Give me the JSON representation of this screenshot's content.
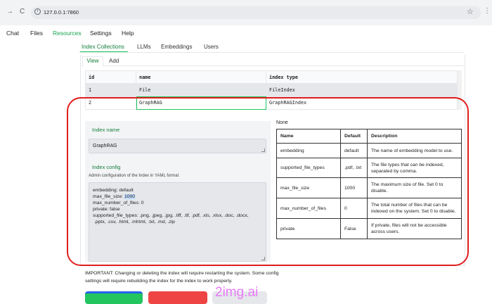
{
  "browser": {
    "back_glyph": "→",
    "reload_glyph": "C",
    "url": "127.0.0.1:7860",
    "star_glyph": "☆",
    "kebab_glyph": "⋮"
  },
  "menu": [
    {
      "label": "Chat"
    },
    {
      "label": "Files"
    },
    {
      "label": "Resources"
    },
    {
      "label": "Settings"
    },
    {
      "label": "Help"
    }
  ],
  "subtabs": [
    {
      "label": "Index Collections"
    },
    {
      "label": "LLMs"
    },
    {
      "label": "Embeddings"
    },
    {
      "label": "Users"
    }
  ],
  "view_tabs": {
    "view": "View",
    "add": "Add"
  },
  "index_table": {
    "headers": [
      "id",
      "name",
      "index type"
    ],
    "rows": [
      [
        "1",
        "File",
        "FileIndex"
      ],
      [
        "2",
        "GraphRAG",
        "GraphRAGIndex"
      ]
    ]
  },
  "detail": {
    "name_label": "Index name",
    "name_value": "GraphRAG",
    "config_label": "Index config",
    "config_hint": "Admin configuration of the Index in YAML format",
    "config_lines": {
      "l1": "embedding: default",
      "l2_pre": "max_file_size: ",
      "l2_hl": "1000",
      "l3": "max_number_of_files: 0",
      "l4": "private: false",
      "l5": "supported_file_types: .png, .jpeg, .jpg, .tiff, .tif, .pdf, .xls, .xlsx, .doc, .docx,",
      "l6": " .pptx, .csv, .html, .mhtml, .txt, .md, .zip"
    }
  },
  "info": {
    "none_label": "None",
    "headers": [
      "Name",
      "Default",
      "Description"
    ],
    "rows": [
      [
        "embedding",
        "default",
        "The name of embedding model to use."
      ],
      [
        "supported_file_types",
        ".pdf, .txt",
        "The file types that can be indexed, separated by comma."
      ],
      [
        "max_file_size",
        "1000",
        "The maximum size of file. Set 0 to disable."
      ],
      [
        "max_number_of_files",
        "0",
        "The total number of files that can be indexed on the system. Set 0 to disable."
      ],
      [
        "private",
        "False",
        "If private, files will not be accessible across users."
      ]
    ]
  },
  "important_note": "IMPORTANT: Changing or deleting the index will require restarting the system. Some config settings will require rebuilding the index for the index to work properly.",
  "watermark": "2img.ai",
  "colors": {
    "accent_green": "#16a34a",
    "annotation_red": "#e11d1d",
    "delete_red": "#ef4444"
  }
}
